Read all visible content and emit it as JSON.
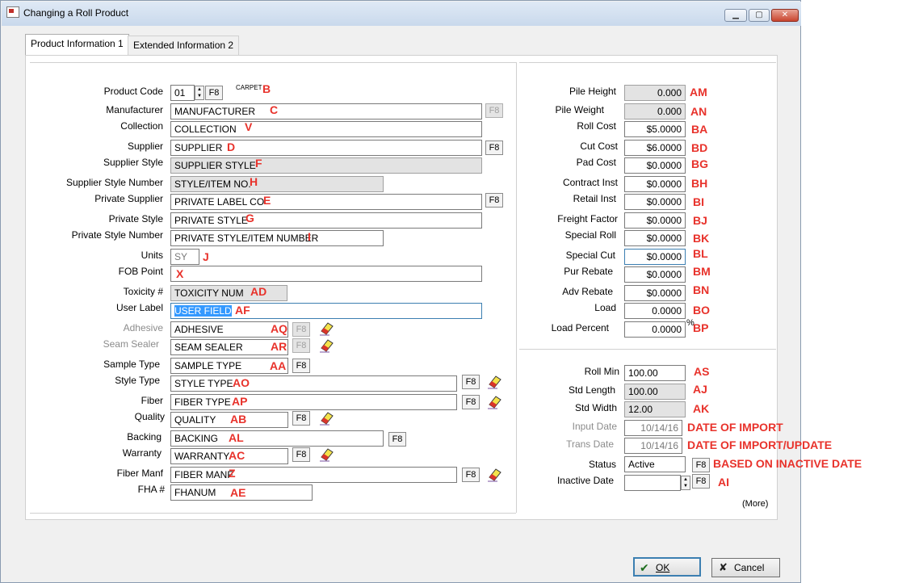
{
  "window": {
    "title": "Changing a Roll Product"
  },
  "tabs": [
    {
      "label": "Product Information 1"
    },
    {
      "label": "Extended Information 2"
    }
  ],
  "left": {
    "product_code": {
      "label": "Product Code",
      "value": "01",
      "button": "F8",
      "desc": "CARPET",
      "ann": "B"
    },
    "manufacturer": {
      "label": "Manufacturer",
      "value": "MANUFACTURER",
      "button": "F8",
      "ann": "C"
    },
    "collection": {
      "label": "Collection",
      "value": "COLLECTION",
      "ann": "V"
    },
    "supplier": {
      "label": "Supplier",
      "value": "SUPPLIER",
      "button": "F8",
      "ann": "D"
    },
    "supplier_style": {
      "label": "Supplier Style",
      "value": "SUPPLIER STYLE",
      "ann": "F"
    },
    "supplier_style_number": {
      "label": "Supplier Style Number",
      "value": "STYLE/ITEM NO.",
      "ann": "H"
    },
    "private_supplier": {
      "label": "Private Supplier",
      "value": "PRIVATE LABEL CO",
      "button": "F8",
      "ann": "E"
    },
    "private_style": {
      "label": "Private Style",
      "value": "PRIVATE STYLE",
      "ann": "G"
    },
    "private_style_number": {
      "label": "Private Style Number",
      "value": "PRIVATE STYLE/ITEM NUMBER",
      "ann": "I"
    },
    "units": {
      "label": "Units",
      "value": "SY",
      "ann": "J"
    },
    "fob_point": {
      "label": "FOB Point",
      "value": "",
      "ann": "X"
    },
    "toxicity": {
      "label": "Toxicity #",
      "value": "TOXICITY NUM",
      "ann": "AD"
    },
    "user_label": {
      "label": "User Label",
      "value": "USER FIELD",
      "ann": "AF"
    },
    "adhesive": {
      "label": "Adhesive",
      "value": "ADHESIVE",
      "button": "F8",
      "ann": "AQ"
    },
    "seam_sealer": {
      "label": "Seam Sealer",
      "value": "SEAM SEALER",
      "button": "F8",
      "ann": "AR"
    },
    "sample_type": {
      "label": "Sample Type",
      "value": "SAMPLE TYPE",
      "button": "F8",
      "ann": "AA"
    },
    "style_type": {
      "label": "Style Type",
      "value": "STYLE TYPE",
      "button": "F8",
      "ann": "AO"
    },
    "fiber": {
      "label": "Fiber",
      "value": "FIBER TYPE",
      "button": "F8",
      "ann": "AP"
    },
    "quality": {
      "label": "Quality",
      "value": "QUALITY",
      "button": "F8",
      "ann": "AB"
    },
    "backing": {
      "label": "Backing",
      "value": "BACKING",
      "button": "F8",
      "ann": "AL"
    },
    "warranty": {
      "label": "Warranty",
      "value": "WARRANTY",
      "button": "F8",
      "ann": "AC"
    },
    "fiber_manf": {
      "label": "Fiber Manf",
      "value": "FIBER MANF",
      "button": "F8",
      "ann": "Z"
    },
    "fha": {
      "label": "FHA #",
      "value": "FHANUM",
      "ann": "AE"
    }
  },
  "right": {
    "pile_height": {
      "label": "Pile Height",
      "value": "0.000",
      "ann": "AM"
    },
    "pile_weight": {
      "label": "Pile Weight",
      "value": "0.000",
      "ann": "AN"
    },
    "roll_cost": {
      "label": "Roll Cost",
      "value": "$5.0000",
      "ann": "BA"
    },
    "cut_cost": {
      "label": "Cut Cost",
      "value": "$6.0000",
      "ann": "BD"
    },
    "pad_cost": {
      "label": "Pad Cost",
      "value": "$0.0000",
      "ann": "BG"
    },
    "contract_inst": {
      "label": "Contract Inst",
      "value": "$0.0000",
      "ann": "BH"
    },
    "retail_inst": {
      "label": "Retail Inst",
      "value": "$0.0000",
      "ann": "BI"
    },
    "freight_factor": {
      "label": "Freight Factor",
      "value": "$0.0000",
      "ann": "BJ"
    },
    "special_roll": {
      "label": "Special Roll",
      "value": "$0.0000",
      "ann": "BK"
    },
    "special_cut": {
      "label": "Special Cut",
      "value": "$0.0000",
      "ann": "BL"
    },
    "pur_rebate": {
      "label": "Pur Rebate",
      "value": "$0.0000",
      "ann": "BM"
    },
    "adv_rebate": {
      "label": "Adv Rebate",
      "value": "$0.0000",
      "ann": "BN"
    },
    "load": {
      "label": "Load",
      "value": "0.0000",
      "ann": "BO"
    },
    "load_percent": {
      "label": "Load Percent",
      "value": "0.0000",
      "suffix": "%",
      "ann": "BP"
    },
    "roll_min": {
      "label": "Roll Min",
      "value": "100.00",
      "ann": "AS"
    },
    "std_length": {
      "label": "Std Length",
      "value": "100.00",
      "ann": "AJ"
    },
    "std_width": {
      "label": "Std Width",
      "value": "12.00",
      "ann": "AK"
    },
    "input_date": {
      "label": "Input Date",
      "value": "10/14/16",
      "ann": "DATE OF IMPORT"
    },
    "trans_date": {
      "label": "Trans Date",
      "value": "10/14/16",
      "ann": "DATE OF IMPORT/UPDATE"
    },
    "status": {
      "label": "Status",
      "value": "Active",
      "button": "F8",
      "ann": "BASED ON INACTIVE DATE"
    },
    "inactive_date": {
      "label": "Inactive Date",
      "value": "",
      "button": "F8",
      "ann": "AI"
    },
    "more": "(More)"
  },
  "buttons": {
    "ok": "OK",
    "cancel": "Cancel"
  },
  "icons": {
    "eraser": "eraser-icon",
    "check": "check-icon",
    "x": "x-icon"
  },
  "colors": {
    "annotation": "#e8322b",
    "selection": "#3399ff"
  }
}
